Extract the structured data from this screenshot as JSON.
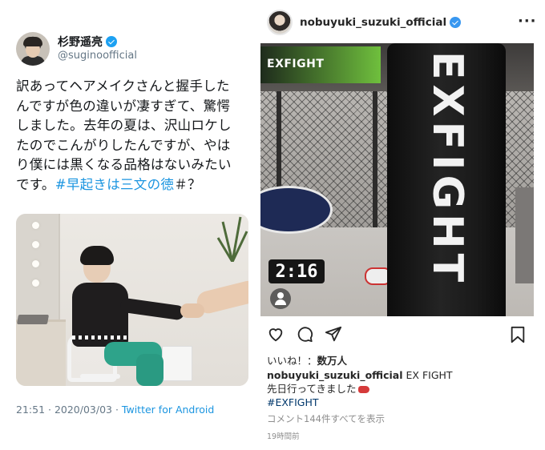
{
  "twitter": {
    "display_name": "杉野遥亮",
    "handle": "@suginoofficial",
    "tweet_lines": [
      "訳あってヘアメイクさんと握手した",
      "んですが色の違いが凄すぎて、驚愕",
      "しました。去年の夏は、沢山ロケし",
      "たのでこんがりしたんですが、やは",
      "り僕には黒くなる品格はないみたい"
    ],
    "tweet_last_prefix": "です。",
    "hashtag": "#早起きは三文の徳",
    "tweet_last_suffix": "＃？",
    "timestamp": "21:51 · 2020/03/03 · ",
    "client": "Twitter for Android",
    "verified_color": "#1da1f2",
    "link_color": "#1b95e0"
  },
  "instagram": {
    "username": "nobuyuki_suzuki_official",
    "more_icon": "···",
    "photo": {
      "screen_text": "EXFIGHT",
      "clock_text": "2:16",
      "bag_text": "EXFIGHT"
    },
    "actions": [
      "heart-icon",
      "comment-icon",
      "share-icon",
      "bookmark-icon"
    ],
    "likes_label": "いいね！：",
    "likes_count": "数万人",
    "caption_user": "nobuyuki_suzuki_official",
    "caption_title": "EX FIGHT",
    "caption_line2": "先日行ってきました",
    "caption_hashtag": "#EXFIGHT",
    "comments_link": "コメント144件すべてを表示",
    "time_ago": "19時間前",
    "hashtag_color": "#00376b"
  }
}
